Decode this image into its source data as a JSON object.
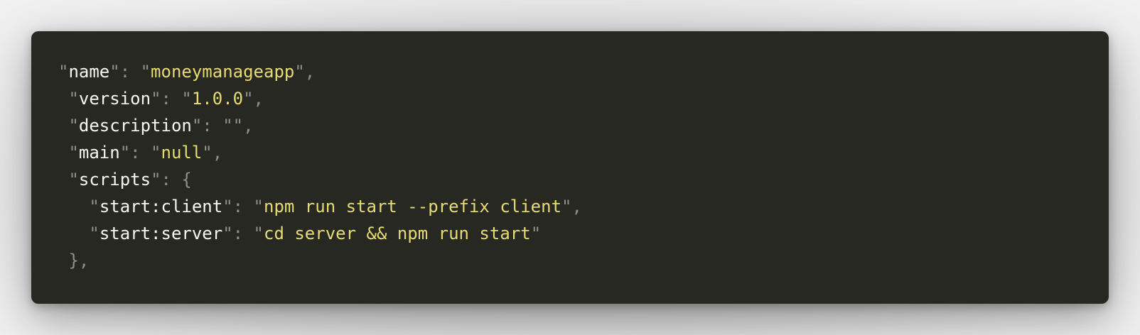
{
  "code_block": {
    "language": "json",
    "background_color": "#272822",
    "key_color": "#f8f8f2",
    "string_color": "#e6db74",
    "punctuation_color": "#8f908a",
    "lines": {
      "name": {
        "key": "name",
        "value": "moneymanageapp"
      },
      "version": {
        "key": "version",
        "value": "1.0.0"
      },
      "description": {
        "key": "description",
        "value": ""
      },
      "main": {
        "key": "main",
        "value": "null"
      },
      "scripts": {
        "key": "scripts",
        "open": "{"
      },
      "start_client": {
        "key": "start:client",
        "value": "npm run start --prefix client"
      },
      "start_server": {
        "key": "start:server",
        "value": "cd server && npm run start"
      },
      "scripts_close": {
        "text": "},"
      }
    }
  }
}
